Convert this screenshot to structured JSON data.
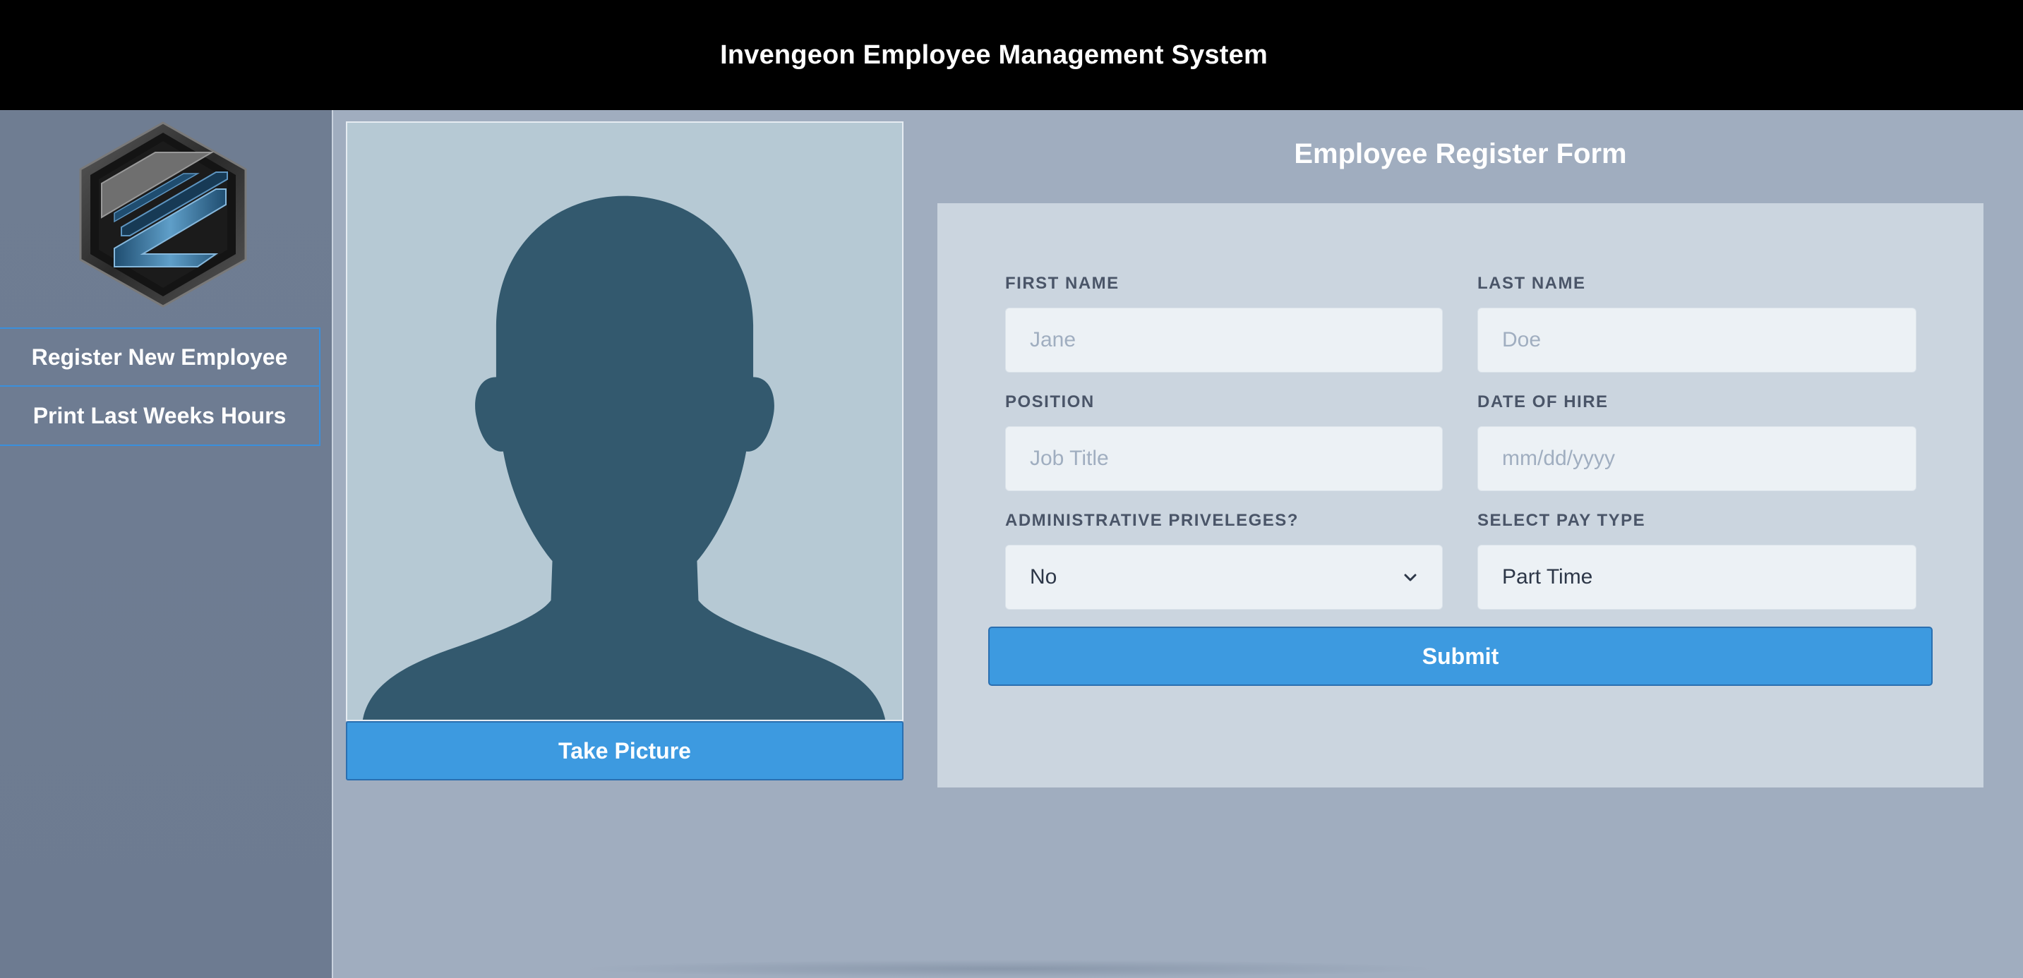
{
  "header": {
    "title": "Invengeon Employee Management System"
  },
  "sidebar": {
    "logo_icon": "invengeon-hexagon-logo",
    "items": [
      {
        "label": "Register New Employee"
      },
      {
        "label": "Print Last Weeks Hours"
      }
    ]
  },
  "photo": {
    "placeholder_icon": "person-silhouette-icon",
    "take_picture_label": "Take Picture"
  },
  "form": {
    "title": "Employee Register Form",
    "first_name": {
      "label": "FIRST NAME",
      "placeholder": "Jane",
      "value": ""
    },
    "last_name": {
      "label": "LAST NAME",
      "placeholder": "Doe",
      "value": ""
    },
    "position": {
      "label": "POSITION",
      "placeholder": "Job Title",
      "value": ""
    },
    "date_of_hire": {
      "label": "DATE OF HIRE",
      "placeholder": "mm/dd/yyyy",
      "value": ""
    },
    "admin": {
      "label": "ADMINISTRATIVE PRIVELEGES?",
      "value": "No"
    },
    "pay_type": {
      "label": "SELECT PAY TYPE",
      "value": "Part Time"
    },
    "submit_label": "Submit"
  },
  "colors": {
    "header_bg": "#000000",
    "sidebar_bg": "#6f7d92",
    "main_bg": "#a0adbf",
    "card_bg": "#cbd5df",
    "accent": "#3d9ae0",
    "silhouette": "#33596e",
    "photo_bg": "#b6c9d4"
  }
}
